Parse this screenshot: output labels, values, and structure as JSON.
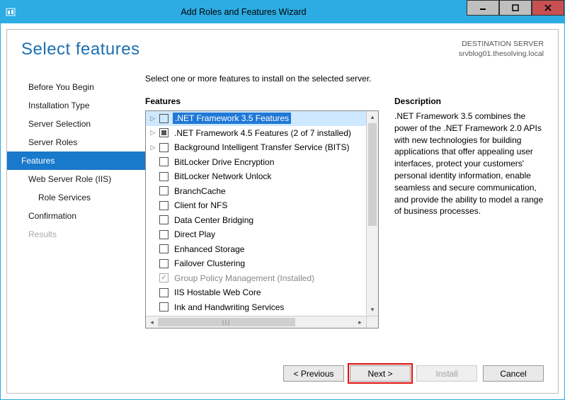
{
  "window": {
    "title": "Add Roles and Features Wizard"
  },
  "header": {
    "page_title": "Select features",
    "destination_label": "DESTINATION SERVER",
    "destination_value": "srvblog01.thesolving.local"
  },
  "nav": {
    "items": [
      {
        "label": "Before You Begin",
        "state": "normal"
      },
      {
        "label": "Installation Type",
        "state": "normal"
      },
      {
        "label": "Server Selection",
        "state": "normal"
      },
      {
        "label": "Server Roles",
        "state": "normal"
      },
      {
        "label": "Features",
        "state": "active"
      },
      {
        "label": "Web Server Role (IIS)",
        "state": "normal"
      },
      {
        "label": "Role Services",
        "state": "sub"
      },
      {
        "label": "Confirmation",
        "state": "normal"
      },
      {
        "label": "Results",
        "state": "disabled"
      }
    ]
  },
  "main": {
    "instruction": "Select one or more features to install on the selected server.",
    "features_label": "Features",
    "description_label": "Description",
    "description_text": ".NET Framework 3.5 combines the power of the .NET Framework 2.0 APIs with new technologies for building applications that offer appealing user interfaces, protect your customers' personal identity information, enable seamless and secure communication, and provide the ability to model a range of business processes.",
    "features": [
      {
        "label": ".NET Framework 3.5 Features",
        "expandable": true,
        "check": "none",
        "selected": true
      },
      {
        "label": ".NET Framework 4.5 Features (2 of 7 installed)",
        "expandable": true,
        "check": "filled"
      },
      {
        "label": "Background Intelligent Transfer Service (BITS)",
        "expandable": true,
        "check": "none"
      },
      {
        "label": "BitLocker Drive Encryption",
        "expandable": false,
        "check": "none"
      },
      {
        "label": "BitLocker Network Unlock",
        "expandable": false,
        "check": "none"
      },
      {
        "label": "BranchCache",
        "expandable": false,
        "check": "none"
      },
      {
        "label": "Client for NFS",
        "expandable": false,
        "check": "none"
      },
      {
        "label": "Data Center Bridging",
        "expandable": false,
        "check": "none"
      },
      {
        "label": "Direct Play",
        "expandable": false,
        "check": "none"
      },
      {
        "label": "Enhanced Storage",
        "expandable": false,
        "check": "none"
      },
      {
        "label": "Failover Clustering",
        "expandable": false,
        "check": "none"
      },
      {
        "label": "Group Policy Management (Installed)",
        "expandable": false,
        "check": "checked",
        "installed": true
      },
      {
        "label": "IIS Hostable Web Core",
        "expandable": false,
        "check": "none"
      },
      {
        "label": "Ink and Handwriting Services",
        "expandable": false,
        "check": "none"
      }
    ]
  },
  "footer": {
    "previous": "< Previous",
    "next": "Next >",
    "install": "Install",
    "cancel": "Cancel"
  }
}
